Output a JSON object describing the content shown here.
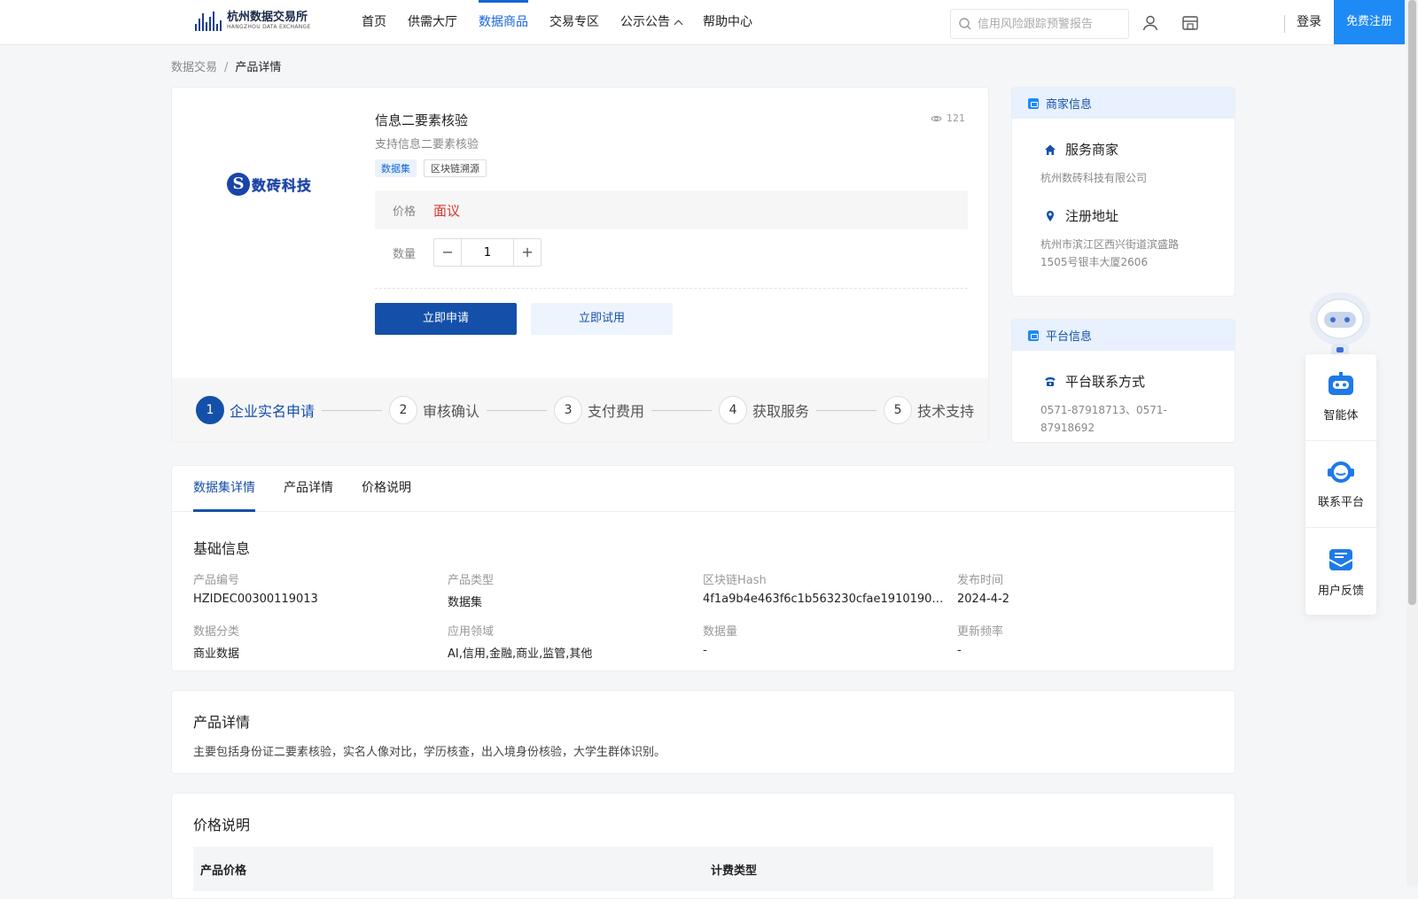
{
  "header": {
    "logo_cn": "杭州数据交易所",
    "logo_en": "HANGZHOU DATA EXCHANGE",
    "nav": [
      {
        "label": "首页"
      },
      {
        "label": "供需大厅"
      },
      {
        "label": "数据商品"
      },
      {
        "label": "交易专区"
      },
      {
        "label": "公示公告"
      },
      {
        "label": "帮助中心"
      }
    ],
    "search_placeholder": "信用风险跟踪预警报告",
    "login_label": "登录",
    "register_label": "免费注册",
    "accent": "#1e8af5"
  },
  "breadcrumb": {
    "root": "数据交易",
    "sep": "/",
    "current": "产品详情"
  },
  "product": {
    "brand_letter": "S",
    "brand_name": "数砖科技",
    "title": "信息二要素核验",
    "views": "121",
    "subtitle": "支持信息二要素核验",
    "tags": [
      "数据集",
      "区块链溯源"
    ],
    "price_label": "价格",
    "price_value": "面议",
    "qty_label": "数量",
    "qty_value": "1",
    "apply_label": "立即申请",
    "try_label": "立即试用",
    "steps": [
      {
        "num": "1",
        "label": "企业实名申请"
      },
      {
        "num": "2",
        "label": "审核确认"
      },
      {
        "num": "3",
        "label": "支付费用"
      },
      {
        "num": "4",
        "label": "获取服务"
      },
      {
        "num": "5",
        "label": "技术支持"
      }
    ]
  },
  "merchant": {
    "heading": "商家信息",
    "service_title": "服务商家",
    "service_value": "杭州数砖科技有限公司",
    "address_title": "注册地址",
    "address_value": "杭州市滨江区西兴街道滨盛路1505号银丰大厦2606"
  },
  "platform": {
    "heading": "平台信息",
    "contact_title": "平台联系方式",
    "contact_value": "0571-87918713、0571-87918692"
  },
  "tabs": [
    {
      "label": "数据集详情"
    },
    {
      "label": "产品详情"
    },
    {
      "label": "价格说明"
    }
  ],
  "basic": {
    "title": "基础信息",
    "fields": [
      {
        "label": "产品编号",
        "value": "HZIDEC00300119013"
      },
      {
        "label": "产品类型",
        "value": "数据集"
      },
      {
        "label": "区块链Hash",
        "value": "4f1a9b4e463f6c1b563230cfae19101909a..."
      },
      {
        "label": "发布时间",
        "value": "2024-4-2"
      },
      {
        "label": "数据分类",
        "value": "商业数据"
      },
      {
        "label": "应用领域",
        "value": "AI,信用,金融,商业,监管,其他"
      },
      {
        "label": "数据量",
        "value": "-"
      },
      {
        "label": "更新频率",
        "value": "-"
      }
    ]
  },
  "detail": {
    "title": "产品详情",
    "text": "主要包括身份证二要素核验，实名人像对比，学历核查，出入境身份核验，大学生群体识别。"
  },
  "pricing": {
    "title": "价格说明",
    "col1": "产品价格",
    "col2": "计费类型"
  },
  "floating": {
    "items": [
      {
        "label": "智能体"
      },
      {
        "label": "联系平台"
      },
      {
        "label": "用户反馈"
      }
    ]
  }
}
